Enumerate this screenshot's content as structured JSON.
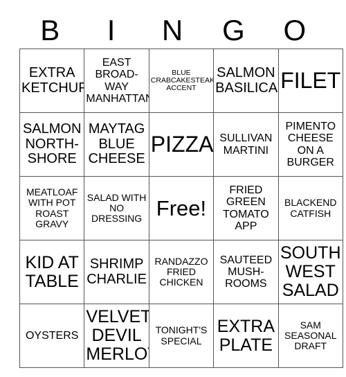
{
  "header": {
    "letters": [
      "B",
      "I",
      "N",
      "G",
      "O"
    ]
  },
  "grid": {
    "rows": 5,
    "columns": 5,
    "cells": [
      [
        {
          "text": "EXTRA KETCHUP",
          "size": "fs-md"
        },
        {
          "text": "EAST BROAD-WAY MANHATTAN",
          "size": "fs-sm"
        },
        {
          "text": "BLUE CRABCAKESTEAK ACCENT",
          "size": "fs-xxs"
        },
        {
          "text": "SALMON BASILICA",
          "size": "fs-md"
        },
        {
          "text": "FILET",
          "size": "fs-xl"
        }
      ],
      [
        {
          "text": "SALMON NORTH-SHORE",
          "size": "fs-md"
        },
        {
          "text": "MAYTAG BLUE CHEESE",
          "size": "fs-md"
        },
        {
          "text": "PIZZA",
          "size": "fs-xl"
        },
        {
          "text": "SULLIVAN MARTINI",
          "size": "fs-sm"
        },
        {
          "text": "PIMENTO CHEESE ON A BURGER",
          "size": "fs-sm"
        }
      ],
      [
        {
          "text": "MEATLOAF WITH POT ROAST GRAVY",
          "size": "fs-xs"
        },
        {
          "text": "SALAD WITH NO DRESSING",
          "size": "fs-xs"
        },
        {
          "text": "Free!",
          "size": "fs-free"
        },
        {
          "text": "FRIED GREEN TOMATO APP",
          "size": "fs-sm"
        },
        {
          "text": "BLACKEND CATFISH",
          "size": "fs-xs"
        }
      ],
      [
        {
          "text": "KID AT TABLE",
          "size": "fs-lg"
        },
        {
          "text": "SHRIMP CHARLIE",
          "size": "fs-md"
        },
        {
          "text": "RANDAZZO FRIED CHICKEN",
          "size": "fs-xs"
        },
        {
          "text": "SAUTEED MUSH-ROOMS",
          "size": "fs-sm"
        },
        {
          "text": "SOUTH WEST SALAD",
          "size": "fs-lg"
        }
      ],
      [
        {
          "text": "OYSTERS",
          "size": "fs-sm"
        },
        {
          "text": "VELVET DEVIL MERLOT",
          "size": "fs-lg"
        },
        {
          "text": "TONIGHT'S SPECIAL",
          "size": "fs-xs"
        },
        {
          "text": "EXTRA PLATE",
          "size": "fs-lg"
        },
        {
          "text": "SAM SEASONAL DRAFT",
          "size": "fs-xs"
        }
      ]
    ]
  },
  "colors": {
    "background": "#ffffff",
    "text": "#000000",
    "border": "#555555"
  }
}
